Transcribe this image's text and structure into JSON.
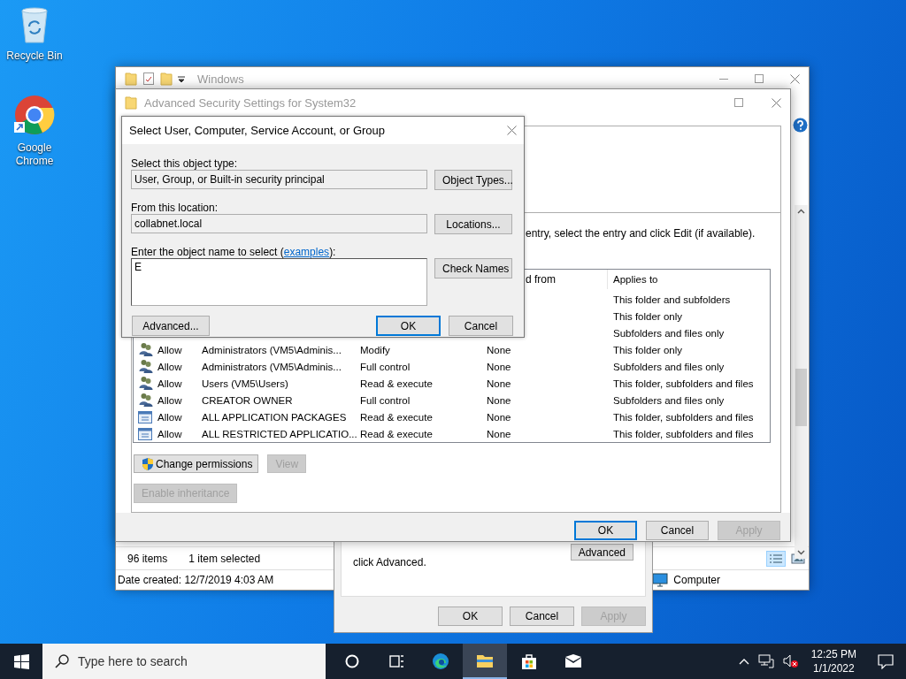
{
  "desktop_icons": [
    {
      "kind": "recycle-bin",
      "label": "Recycle Bin"
    },
    {
      "kind": "chrome",
      "label": "Google Chrome"
    }
  ],
  "explorer": {
    "title": "Windows",
    "status_items": "96 items",
    "status_selected": "1 item selected",
    "date_created": "Date created: 12/7/2019 4:03 AM",
    "location": "Computer"
  },
  "properties_dialog": {
    "note": "click Advanced.",
    "advanced_button": "Advanced",
    "buttons": [
      {
        "label": "OK",
        "disabled": false
      },
      {
        "label": "Cancel",
        "disabled": false
      },
      {
        "label": "Apply",
        "disabled": true
      }
    ]
  },
  "security_window": {
    "title": "Advanced Security Settings for System32",
    "instruction": "entry, select the entry and click Edit (if available).",
    "columns": [
      "d from",
      "Applies to"
    ],
    "rows": [
      {
        "applies_to": "This folder and subfolders"
      },
      {
        "applies_to": "This folder only"
      },
      {
        "applies_to": "Subfolders and files only"
      },
      {
        "kind": "group",
        "type": "Allow",
        "principal": "Administrators (VM5\\Adminis...",
        "access": "Modify",
        "inherited_from": "None",
        "applies_to": "This folder only"
      },
      {
        "kind": "group",
        "type": "Allow",
        "principal": "Administrators (VM5\\Adminis...",
        "access": "Full control",
        "inherited_from": "None",
        "applies_to": "Subfolders and files only"
      },
      {
        "kind": "group",
        "type": "Allow",
        "principal": "Users (VM5\\Users)",
        "access": "Read & execute",
        "inherited_from": "None",
        "applies_to": "This folder, subfolders and files"
      },
      {
        "kind": "group",
        "type": "Allow",
        "principal": "CREATOR OWNER",
        "access": "Full control",
        "inherited_from": "None",
        "applies_to": "Subfolders and files only"
      },
      {
        "kind": "package",
        "type": "Allow",
        "principal": "ALL APPLICATION PACKAGES",
        "access": "Read & execute",
        "inherited_from": "None",
        "applies_to": "This folder, subfolders and files"
      },
      {
        "kind": "package",
        "type": "Allow",
        "principal": "ALL RESTRICTED APPLICATIO...",
        "access": "Read & execute",
        "inherited_from": "None",
        "applies_to": "This folder, subfolders and files"
      }
    ],
    "change_permissions_button": {
      "label": "Change permissions",
      "disabled": false
    },
    "view_button": {
      "label": "View",
      "disabled": true
    },
    "enable_inheritance_button": {
      "label": "Enable inheritance",
      "disabled": true
    },
    "buttons": [
      {
        "label": "OK",
        "disabled": false,
        "default": true
      },
      {
        "label": "Cancel",
        "disabled": false,
        "default": false
      },
      {
        "label": "Apply",
        "disabled": true,
        "default": false
      }
    ]
  },
  "select_dialog": {
    "title": "Select User, Computer, Service Account, or Group",
    "object_type_label": "Select this object type:",
    "object_type": "User, Group, or Built-in security principal",
    "object_types_button": "Object Types...",
    "location_label": "From this location:",
    "location": "collabnet.local",
    "locations_button": "Locations...",
    "name_label_before": "Enter the object name to select (",
    "name_label_link": "examples",
    "name_label_after": "):",
    "name_value": "E",
    "check_names_button": "Check Names",
    "advanced_button": "Advanced...",
    "buttons": [
      {
        "label": "OK",
        "default": true
      },
      {
        "label": "Cancel",
        "default": false
      }
    ]
  },
  "taskbar": {
    "search_placeholder": "Type here to search",
    "apps": [
      {
        "kind": "cortana",
        "selected": false
      },
      {
        "kind": "task-view",
        "selected": false
      },
      {
        "kind": "edge",
        "selected": false
      },
      {
        "kind": "explorer",
        "selected": true
      },
      {
        "kind": "store",
        "selected": false
      },
      {
        "kind": "mail",
        "selected": false
      }
    ],
    "time": "12:25 PM",
    "date": "1/1/2022"
  }
}
